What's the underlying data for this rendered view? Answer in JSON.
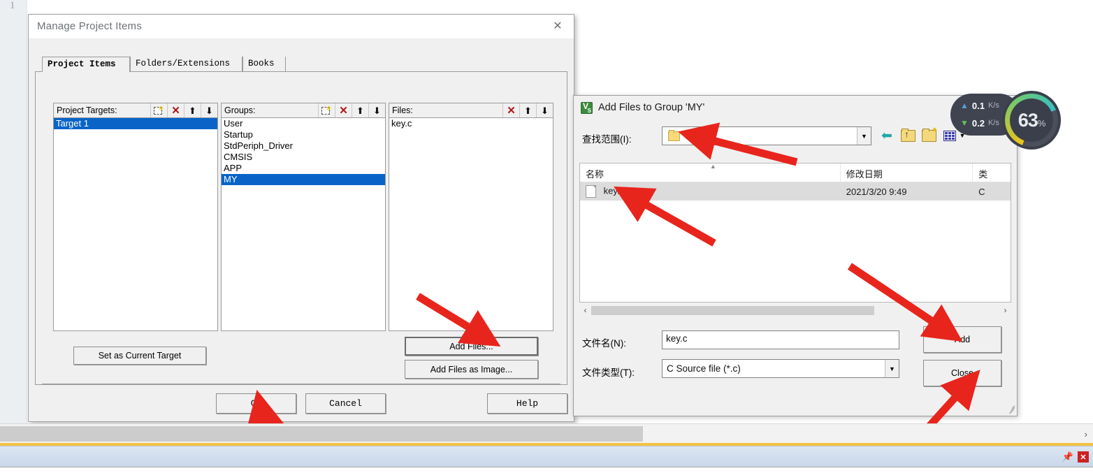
{
  "ide": {
    "line_marker": "1"
  },
  "manage_dialog": {
    "title": "Manage Project Items",
    "close_icon": "close-icon",
    "tabs": [
      {
        "label": "Project Items",
        "active": true
      },
      {
        "label": "Folders/Extensions",
        "active": false
      },
      {
        "label": "Books",
        "active": false
      }
    ],
    "project_targets": {
      "label": "Project Targets:",
      "toolbar": [
        "new-icon",
        "delete-icon",
        "move-up-icon",
        "move-down-icon"
      ],
      "items": [
        {
          "label": "Target 1",
          "selected": true
        }
      ]
    },
    "groups": {
      "label": "Groups:",
      "toolbar": [
        "new-icon",
        "delete-icon",
        "move-up-icon",
        "move-down-icon"
      ],
      "items": [
        {
          "label": "User",
          "selected": false
        },
        {
          "label": "Startup",
          "selected": false
        },
        {
          "label": "StdPeriph_Driver",
          "selected": false
        },
        {
          "label": "CMSIS",
          "selected": false
        },
        {
          "label": "APP",
          "selected": false
        },
        {
          "label": "MY",
          "selected": true
        }
      ]
    },
    "files": {
      "label": "Files:",
      "toolbar": [
        "delete-icon",
        "move-up-icon",
        "move-down-icon"
      ],
      "items": [
        {
          "label": "key.c",
          "selected": false
        }
      ]
    },
    "set_current_target": "Set as Current Target",
    "add_files": "Add Files...",
    "add_files_as_image": "Add Files as Image...",
    "ok": "OK",
    "cancel": "Cancel",
    "help": "Help"
  },
  "add_files_dialog": {
    "title": "Add Files to Group 'MY'",
    "app_icon": "visual-studio-icon",
    "look_in_label": "查找范围(I):",
    "look_in_value": "KEY",
    "toolbar": [
      "back-icon",
      "up-folder-icon",
      "new-folder-icon",
      "view-list-icon"
    ],
    "columns": [
      {
        "label": "名称",
        "sorted": true
      },
      {
        "label": "修改日期",
        "sorted": false
      },
      {
        "label": "类",
        "sorted": false
      }
    ],
    "rows": [
      {
        "name": "key.c",
        "date": "2021/3/20 9:49",
        "type": "C ",
        "selected": true
      }
    ],
    "scroll_left_icon": "chevron-left-icon",
    "scroll_right_icon": "chevron-right-icon",
    "file_name_label": "文件名(N):",
    "file_name_value": "key.c",
    "file_type_label": "文件类型(T):",
    "file_type_value": "C Source file (*.c)",
    "add_button": "Add",
    "close_button": "Close"
  },
  "network_widget": {
    "upload_value": "0.1",
    "upload_unit": "K/s",
    "upload_color": "#4f9bd8",
    "download_value": "0.2",
    "download_unit": "K/s",
    "download_color": "#5fbf5f",
    "gauge_value": "63",
    "gauge_unit": "%",
    "gauge_percent": 63
  },
  "bottom": {
    "scroll_right_icon": "chevron-right-icon",
    "pin_icon": "pin-icon",
    "close_icon": "close-icon"
  },
  "annotations": {
    "accent_color": "#e8251c",
    "arrows": [
      "arrow-to-look-in-combo",
      "arrow-to-key-c-row",
      "arrow-to-add-files-button",
      "arrow-to-add-button",
      "arrow-to-close-button",
      "arrow-to-ok-button"
    ]
  }
}
